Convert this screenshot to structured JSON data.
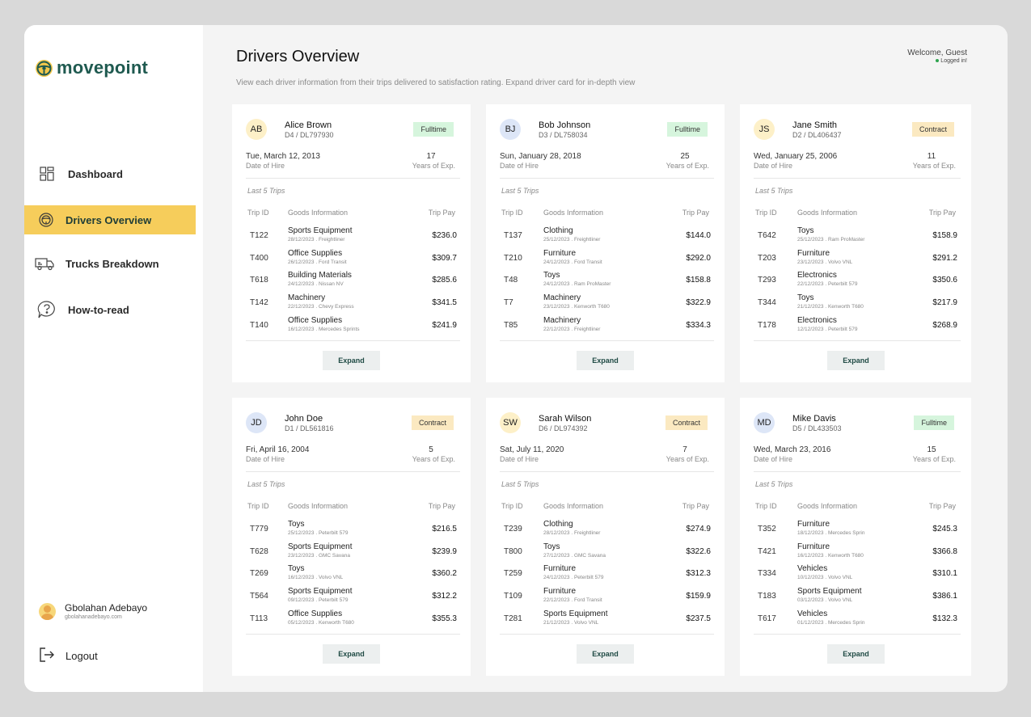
{
  "sidebar": {
    "brand": "movepoint",
    "nav": [
      {
        "label": "Dashboard",
        "icon": "grid-icon",
        "active": false
      },
      {
        "label": "Drivers Overview",
        "icon": "steering-wheel-icon",
        "active": true
      },
      {
        "label": "Trucks Breakdown",
        "icon": "truck-icon",
        "active": false
      },
      {
        "label": "How-to-read",
        "icon": "help-bubble-icon",
        "active": false
      }
    ],
    "user": {
      "name": "Gbolahan Adebayo",
      "email": "gbolahanadebayo.com"
    },
    "logout_label": "Logout"
  },
  "header": {
    "title": "Drivers Overview",
    "subtitle": "View each driver information from their trips delivered to satisfaction rating. Expand driver card for in-depth view",
    "welcome": "Welcome, Guest",
    "status": "Logged in!"
  },
  "labels": {
    "date_of_hire": "Date of Hire",
    "years_exp": "Years of Exp.",
    "last5": "Last 5 Trips",
    "col_trip": "Trip ID",
    "col_goods": "Goods Information",
    "col_pay": "Trip Pay",
    "expand": "Expand"
  },
  "colors": {
    "accent": "#f6cd5b",
    "brand": "#1f5a50",
    "fulltime_badge": "#d6f5dd",
    "contract_badge": "#fbe9c1",
    "avatar_yellow": "#fdf0c8",
    "avatar_blue": "#dde6f7"
  },
  "drivers": [
    {
      "initials": "AB",
      "avatar": "yellow",
      "name": "Alice Brown",
      "license": "D4 / DL797930",
      "type": "Fulltime",
      "hire": "Tue, March 12, 2013",
      "years": "17",
      "trips": [
        {
          "id": "T122",
          "goods": "Sports Equipment",
          "meta": "28/12/2023 . Freightliner",
          "pay": "$236.0"
        },
        {
          "id": "T400",
          "goods": "Office Supplies",
          "meta": "26/12/2023 . Ford Transit",
          "pay": "$309.7"
        },
        {
          "id": "T618",
          "goods": "Building Materials",
          "meta": "24/12/2023 . Nissan NV",
          "pay": "$285.6"
        },
        {
          "id": "T142",
          "goods": "Machinery",
          "meta": "22/12/2023 . Chevy Express",
          "pay": "$341.5"
        },
        {
          "id": "T140",
          "goods": "Office Supplies",
          "meta": "16/12/2023 . Mercedes Sprints",
          "pay": "$241.9"
        }
      ]
    },
    {
      "initials": "BJ",
      "avatar": "blue",
      "name": "Bob Johnson",
      "license": "D3 / DL758034",
      "type": "Fulltime",
      "hire": "Sun, January 28, 2018",
      "years": "25",
      "trips": [
        {
          "id": "T137",
          "goods": "Clothing",
          "meta": "25/12/2023 . Freightliner",
          "pay": "$144.0"
        },
        {
          "id": "T210",
          "goods": "Furniture",
          "meta": "24/12/2023 . Ford Transit",
          "pay": "$292.0"
        },
        {
          "id": "T48",
          "goods": "Toys",
          "meta": "24/12/2023 . Ram ProMaster",
          "pay": "$158.8"
        },
        {
          "id": "T7",
          "goods": "Machinery",
          "meta": "23/12/2023 . Kenworth T680",
          "pay": "$322.9"
        },
        {
          "id": "T85",
          "goods": "Machinery",
          "meta": "22/12/2023 . Freightliner",
          "pay": "$334.3"
        }
      ]
    },
    {
      "initials": "JS",
      "avatar": "yellow",
      "name": "Jane Smith",
      "license": "D2 / DL406437",
      "type": "Contract",
      "hire": "Wed, January 25, 2006",
      "years": "11",
      "trips": [
        {
          "id": "T642",
          "goods": "Toys",
          "meta": "25/12/2023 . Ram ProMaster",
          "pay": "$158.9"
        },
        {
          "id": "T203",
          "goods": "Furniture",
          "meta": "23/12/2023 . Volvo VNL",
          "pay": "$291.2"
        },
        {
          "id": "T293",
          "goods": "Electronics",
          "meta": "22/12/2023 . Peterbilt 579",
          "pay": "$350.6"
        },
        {
          "id": "T344",
          "goods": "Toys",
          "meta": "21/12/2023 . Kenworth T680",
          "pay": "$217.9"
        },
        {
          "id": "T178",
          "goods": "Electronics",
          "meta": "12/12/2023 . Peterbilt 579",
          "pay": "$268.9"
        }
      ]
    },
    {
      "initials": "JD",
      "avatar": "blue",
      "name": "John Doe",
      "license": "D1 / DL561816",
      "type": "Contract",
      "hire": "Fri, April 16, 2004",
      "years": "5",
      "trips": [
        {
          "id": "T779",
          "goods": "Toys",
          "meta": "25/12/2023 . Peterbilt 579",
          "pay": "$216.5"
        },
        {
          "id": "T628",
          "goods": "Sports Equipment",
          "meta": "23/12/2023 . GMC Savana",
          "pay": "$239.9"
        },
        {
          "id": "T269",
          "goods": "Toys",
          "meta": "16/12/2023 . Volvo VNL",
          "pay": "$360.2"
        },
        {
          "id": "T564",
          "goods": "Sports Equipment",
          "meta": "09/12/2023 . Peterbilt 579",
          "pay": "$312.2"
        },
        {
          "id": "T113",
          "goods": "Office Supplies",
          "meta": "05/12/2023 . Kenworth T680",
          "pay": "$355.3"
        }
      ]
    },
    {
      "initials": "SW",
      "avatar": "yellow",
      "name": "Sarah Wilson",
      "license": "D6 / DL974392",
      "type": "Contract",
      "hire": "Sat, July 11, 2020",
      "years": "7",
      "trips": [
        {
          "id": "T239",
          "goods": "Clothing",
          "meta": "28/12/2023 . Freightliner",
          "pay": "$274.9"
        },
        {
          "id": "T800",
          "goods": "Toys",
          "meta": "27/12/2023 . GMC Savana",
          "pay": "$322.6"
        },
        {
          "id": "T259",
          "goods": "Furniture",
          "meta": "24/12/2023 . Peterbilt 579",
          "pay": "$312.3"
        },
        {
          "id": "T109",
          "goods": "Furniture",
          "meta": "22/12/2023 . Ford Transit",
          "pay": "$159.9"
        },
        {
          "id": "T281",
          "goods": "Sports Equipment",
          "meta": "21/12/2023 . Volvo VNL",
          "pay": "$237.5"
        }
      ]
    },
    {
      "initials": "MD",
      "avatar": "blue",
      "name": "Mike Davis",
      "license": "D5 / DL433503",
      "type": "Fulltime",
      "hire": "Wed, March 23, 2016",
      "years": "15",
      "trips": [
        {
          "id": "T352",
          "goods": "Furniture",
          "meta": "18/12/2023 . Mercedes Sprin",
          "pay": "$245.3"
        },
        {
          "id": "T421",
          "goods": "Furniture",
          "meta": "16/12/2023 . Kenworth T680",
          "pay": "$366.8"
        },
        {
          "id": "T334",
          "goods": "Vehicles",
          "meta": "10/12/2023 . Volvo VNL",
          "pay": "$310.1"
        },
        {
          "id": "T183",
          "goods": "Sports Equipment",
          "meta": "03/12/2023 . Volvo VNL",
          "pay": "$386.1"
        },
        {
          "id": "T617",
          "goods": "Vehicles",
          "meta": "01/12/2023 . Mercedes Sprin",
          "pay": "$132.3"
        }
      ]
    }
  ]
}
